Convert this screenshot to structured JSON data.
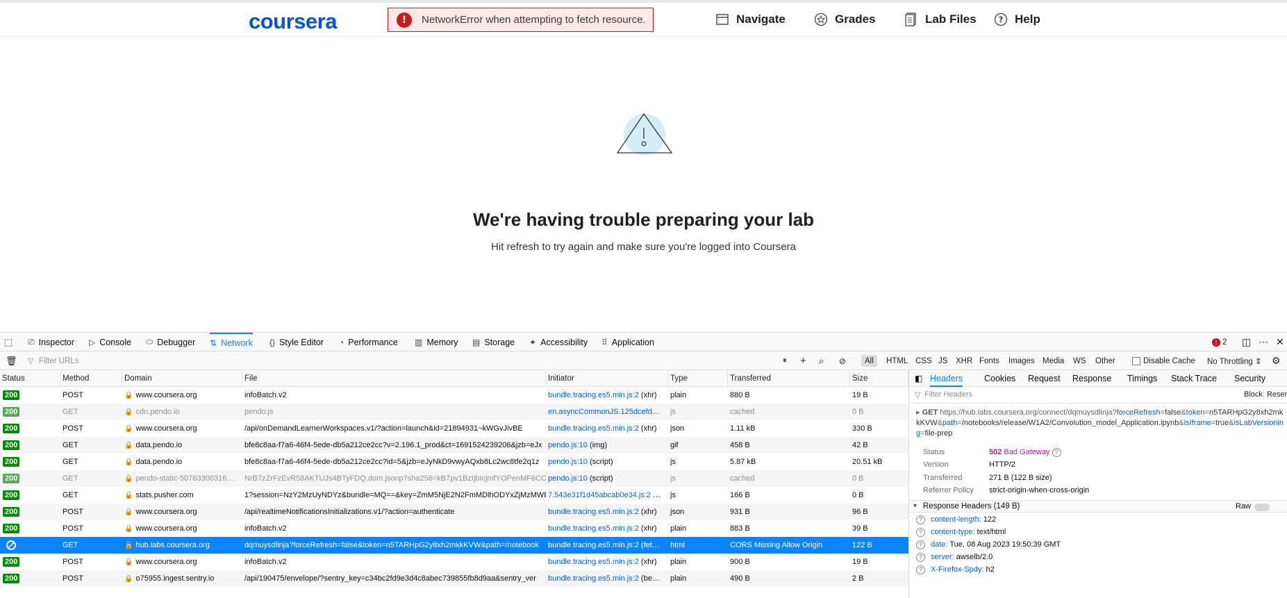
{
  "header": {
    "logo_text": "coursera",
    "error_message": "NetworkError when attempting to fetch resource.",
    "error_icon": "!",
    "nav": [
      {
        "label": "Navigate",
        "icon": "navigate-icon"
      },
      {
        "label": "Grades",
        "icon": "star-icon"
      },
      {
        "label": "Lab Files",
        "icon": "files-icon"
      },
      {
        "label": "Help",
        "icon": "help-icon"
      }
    ]
  },
  "main": {
    "title": "We're having trouble preparing your lab",
    "subtitle": "Hit refresh to try again and make sure you're logged into Coursera"
  },
  "devtools": {
    "tabs": [
      {
        "label": "Inspector",
        "icon": "⎚"
      },
      {
        "label": "Console",
        "icon": "▷"
      },
      {
        "label": "Debugger",
        "icon": "⬭"
      },
      {
        "label": "Network",
        "icon": "⇅"
      },
      {
        "label": "Style Editor",
        "icon": "{}"
      },
      {
        "label": "Performance",
        "icon": "◔"
      },
      {
        "label": "Memory",
        "icon": "▥"
      },
      {
        "label": "Storage",
        "icon": "▤"
      },
      {
        "label": "Accessibility",
        "icon": "✦"
      },
      {
        "label": "Application",
        "icon": "⠿"
      }
    ],
    "error_count": "2",
    "filter_placeholder": "Filter URLs",
    "type_filters": [
      "All",
      "HTML",
      "CSS",
      "JS",
      "XHR",
      "Fonts",
      "Images",
      "Media",
      "WS",
      "Other"
    ],
    "disable_cache_label": "Disable Cache",
    "throttling_label": "No Throttling ⇕",
    "columns": [
      "Status",
      "Method",
      "Domain",
      "File",
      "Initiator",
      "Type",
      "Transferred",
      "Size"
    ],
    "requests": [
      {
        "status": "200",
        "method": "POST",
        "domain": "www.coursera.org",
        "file": "infoBatch.v2",
        "initiator": "bundle.tracing.es5.min.js:2",
        "init_suffix": " (xhr)",
        "type": "plain",
        "transferred": "880 B",
        "size": "19 B"
      },
      {
        "status": "200",
        "method": "GET",
        "domain": "cdn.pendo.io",
        "file": "pendo.js",
        "initiator": "en.asyncCommonJS.125dcefd…",
        "init_suffix": "",
        "type": "js",
        "transferred": "cached",
        "size": "0 B"
      },
      {
        "status": "200",
        "method": "POST",
        "domain": "www.coursera.org",
        "file": "/api/onDemandLearnerWorkspaces.v1/?action=launch&id=21894931~kWGvJivBE",
        "initiator": "bundle.tracing.es5.min.js:2",
        "init_suffix": " (xhr)",
        "type": "json",
        "transferred": "1.11 kB",
        "size": "330 B"
      },
      {
        "status": "200",
        "method": "GET",
        "domain": "data.pendo.io",
        "file": "bfe8c8aa-f7a6-46f4-5ede-db5a212ce2cc?v=2.196.1_prod&ct=1691524239206&jzb=eJx",
        "initiator": "pendo.js:10",
        "init_suffix": " (img)",
        "type": "gif",
        "transferred": "458 B",
        "size": "42 B"
      },
      {
        "status": "200",
        "method": "GET",
        "domain": "data.pendo.io",
        "file": "bfe8c8aa-f7a6-46f4-5ede-db5a212ce2cc?id=5&jzb=eJyNkD9vwyAQxb8Lc2wc8tfe2q1z",
        "initiator": "pendo.js:10",
        "init_suffix": " (script)",
        "type": "js",
        "transferred": "5.87 kB",
        "size": "20.51 kB"
      },
      {
        "status": "200",
        "method": "GET",
        "domain": "pendo-static-50763300316…",
        "file": "NrB7zZrFzEvR58AKTUJs4BTyFDQ.dom.jsonp?sha256=kB7pv1BzIjbIcjmfYOPenMF6CCn",
        "initiator": "pendo.js:10",
        "init_suffix": " (script)",
        "type": "js",
        "transferred": "cached",
        "size": "0 B"
      },
      {
        "status": "200",
        "method": "GET",
        "domain": "stats.pusher.com",
        "file": "1?session=NzY2MzUyNDYz&bundle=MQ==&key=ZmM5NjE2N2FmMDlhODYxZjMzMWE",
        "initiator": "7.543e31f1d45abcab0e34.js:2",
        "init_suffix": " …",
        "type": "js",
        "transferred": "166 B",
        "size": "0 B"
      },
      {
        "status": "200",
        "method": "POST",
        "domain": "www.coursera.org",
        "file": "/api/realtimeNotificationsInitializations.v1/?action=authenticate",
        "initiator": "bundle.tracing.es5.min.js:2",
        "init_suffix": " (xhr)",
        "type": "json",
        "transferred": "931 B",
        "size": "96 B"
      },
      {
        "status": "200",
        "method": "POST",
        "domain": "www.coursera.org",
        "file": "infoBatch.v2",
        "initiator": "bundle.tracing.es5.min.js:2",
        "init_suffix": " (xhr)",
        "type": "plain",
        "transferred": "883 B",
        "size": "39 B"
      },
      {
        "status": "",
        "method": "GET",
        "domain": "hub.labs.coursera.org",
        "file": "dqmuysdlinja?forceRefresh=false&token=n5TARHpG2y8xh2mkkKVW&path=/notebook",
        "initiator": "bundle.tracing.es5.min.js:2",
        "init_suffix": " (fet…",
        "type": "html",
        "transferred": "CORS Missing Allow Origin",
        "size": "122 B"
      },
      {
        "status": "200",
        "method": "POST",
        "domain": "www.coursera.org",
        "file": "infoBatch.v2",
        "initiator": "bundle.tracing.es5.min.js:2",
        "init_suffix": " (xhr)",
        "type": "plain",
        "transferred": "900 B",
        "size": "19 B"
      },
      {
        "status": "200",
        "method": "POST",
        "domain": "o75955.ingest.sentry.io",
        "file": "/api/190475/envelope/?sentry_key=c34bc2fd9e3d4c8abec739855fb8d9aa&sentry_ver",
        "initiator": "bundle.tracing.es5.min.js:2",
        "init_suffix": " (be…",
        "type": "plain",
        "transferred": "490 B",
        "size": "2 B"
      }
    ],
    "side_tabs": [
      "Headers",
      "Cookies",
      "Request",
      "Response",
      "Timings",
      "Stack Trace",
      "Security"
    ],
    "side_filter_placeholder": "Filter Headers",
    "block_label": "Block",
    "resend_label": "Resenc",
    "request_line": {
      "method": "GET",
      "url_base": "https://hub.labs.coursera.org/connect/dqmuysdlinja?",
      "params": [
        {
          "k": "forceRefresh",
          "v": "false"
        },
        {
          "k": "token",
          "v": "n5TARHpG2y8xh2mkkKVW"
        },
        {
          "k": "path",
          "v": "/notebooks/release/W1A2/Convolution_model_Application.ipynb"
        },
        {
          "k": "isIframe",
          "v": "true"
        },
        {
          "k": "isLabVersioning",
          "v": "file-prep"
        }
      ]
    },
    "summary": [
      {
        "key": "Status",
        "value": "502 Bad Gateway"
      },
      {
        "key": "Version",
        "value": "HTTP/2"
      },
      {
        "key": "Transferred",
        "value": "271 B (122 B size)"
      },
      {
        "key": "Referrer Policy",
        "value": "strict-origin-when-cross-origin"
      }
    ],
    "response_headers_title": "Response Headers (149 B)",
    "raw_label": "Raw",
    "response_headers": [
      {
        "name": "content-length:",
        "value": "122"
      },
      {
        "name": "content-type:",
        "value": "text/html"
      },
      {
        "name": "date:",
        "value": "Tue, 08 Aug 2023 19:50:39 GMT"
      },
      {
        "name": "server:",
        "value": "awselb/2.0"
      },
      {
        "name": "X-Firefox-Spdy:",
        "value": "h2"
      }
    ]
  }
}
